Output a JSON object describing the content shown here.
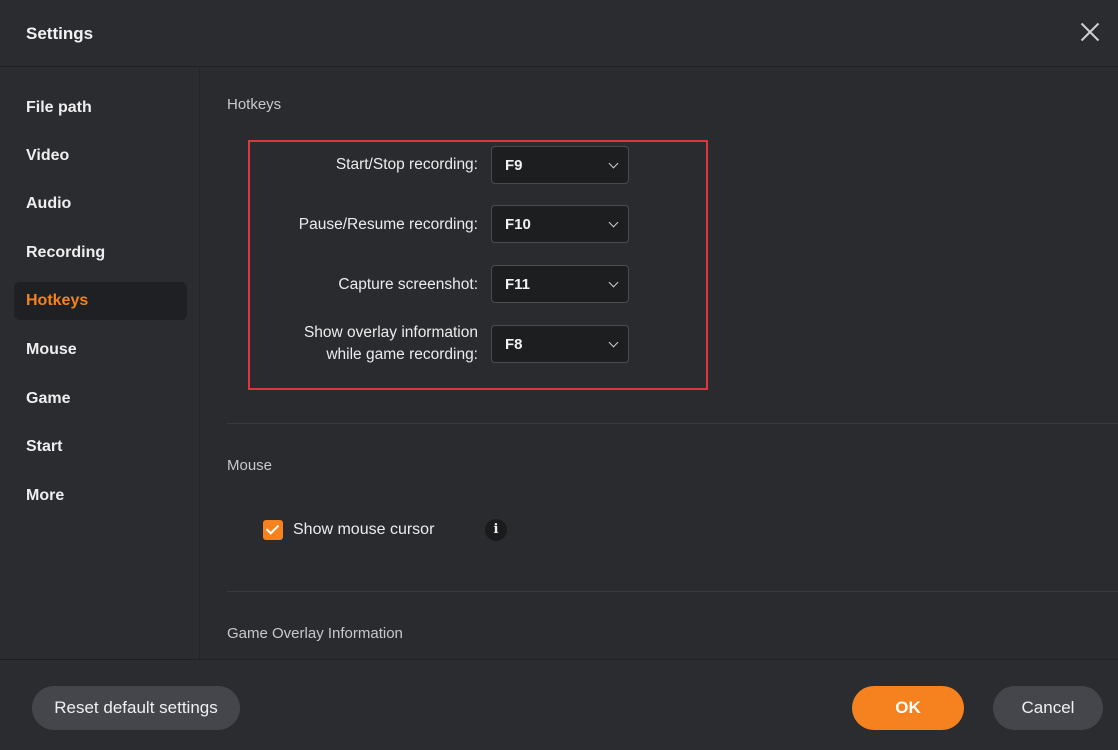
{
  "window": {
    "title": "Settings"
  },
  "sidebar": {
    "items": [
      {
        "label": "File path"
      },
      {
        "label": "Video"
      },
      {
        "label": "Audio"
      },
      {
        "label": "Recording"
      },
      {
        "label": "Hotkeys",
        "active": true
      },
      {
        "label": "Mouse"
      },
      {
        "label": "Game"
      },
      {
        "label": "Start"
      },
      {
        "label": "More"
      }
    ]
  },
  "hotkeys": {
    "section_title": "Hotkeys",
    "rows": [
      {
        "label": "Start/Stop recording:",
        "value": "F9"
      },
      {
        "label": "Pause/Resume recording:",
        "value": "F10"
      },
      {
        "label": "Capture screenshot:",
        "value": "F11"
      },
      {
        "label_line1": "Show overlay information",
        "label_line2": "while game recording:",
        "value": "F8"
      }
    ]
  },
  "mouse": {
    "section_title": "Mouse",
    "show_cursor_label": "Show mouse cursor",
    "show_cursor_checked": true,
    "info_glyph": "i"
  },
  "game_overlay": {
    "section_title": "Game Overlay Information"
  },
  "footer": {
    "reset_label": "Reset default settings",
    "ok_label": "OK",
    "cancel_label": "Cancel"
  },
  "colors": {
    "accent": "#f5821f",
    "highlight_border": "#e0353f",
    "background": "#2a2b2e"
  }
}
